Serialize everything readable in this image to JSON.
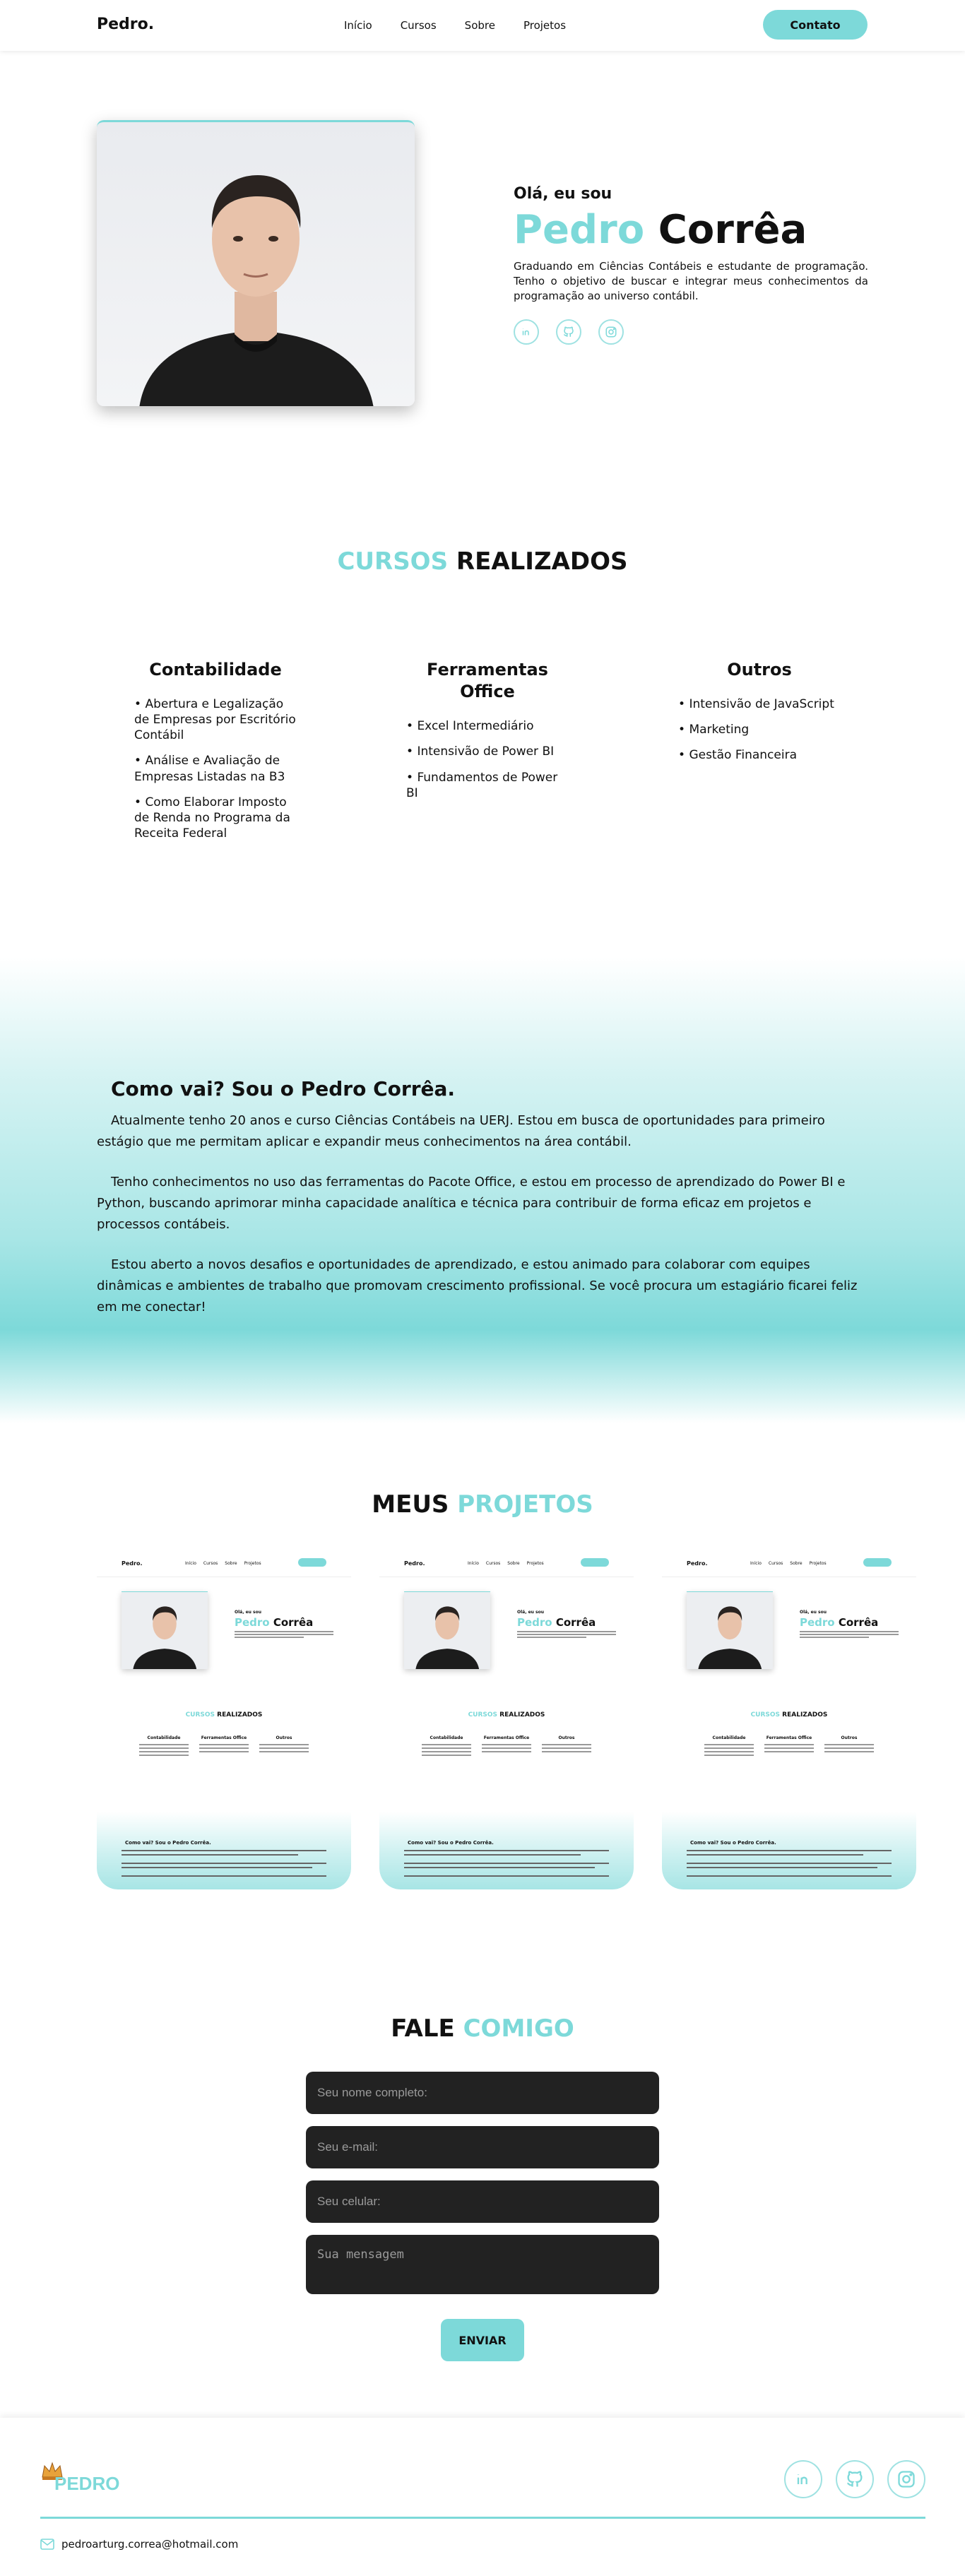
{
  "header": {
    "brand": "Pedro.",
    "nav": [
      "Início",
      "Cursos",
      "Sobre",
      "Projetos"
    ],
    "contact_button": "Contato"
  },
  "hero": {
    "greeting": "Olá, eu sou",
    "first_name": "Pedro",
    "last_name": "Corrêa",
    "bio": "Graduando em Ciências Contábeis e estudante de programação. Tenho o objetivo de buscar e integrar meus conhecimentos da programação ao universo contábil.",
    "socials": [
      "linkedin-icon",
      "github-icon",
      "instagram-icon"
    ]
  },
  "courses": {
    "title_accent": "CURSOS",
    "title_rest": "REALIZADOS",
    "columns": [
      {
        "title": "Contabilidade",
        "items": [
          "Abertura e Legalização de Empresas por Escritório Contábil",
          "Análise e Avaliação de Empresas Listadas na B3",
          "Como Elaborar Imposto de Renda no Programa da Receita Federal"
        ]
      },
      {
        "title": "Ferramentas Office",
        "items": [
          "Excel Intermediário",
          "Intensivão de Power BI",
          "Fundamentos de Power BI"
        ]
      },
      {
        "title": "Outros",
        "items": [
          "Intensivão de JavaScript",
          "Marketing",
          "Gestão Financeira"
        ]
      }
    ]
  },
  "about": {
    "title": "Como vai? Sou o Pedro Corrêa.",
    "paragraphs": [
      "Atualmente tenho 20 anos e curso Ciências Contábeis na UERJ. Estou em busca de oportunidades para primeiro estágio que me permitam aplicar e expandir meus conhecimentos na área contábil.",
      "Tenho conhecimentos no uso das ferramentas do Pacote Office, e estou em processo de aprendizado do Power BI e Python, buscando aprimorar minha capacidade analítica e técnica para contribuir de forma eficaz em projetos e processos contábeis.",
      "Estou aberto a novos desafios e oportunidades de aprendizado, e estou animado para colaborar com equipes dinâmicas e ambientes de trabalho que promovam crescimento profissional. Se você procura um estagiário ficarei feliz em me conectar!"
    ]
  },
  "projects": {
    "title_rest": "MEUS",
    "title_accent": "PROJETOS",
    "mini": {
      "brand": "Pedro.",
      "greeting": "Olá, eu sou",
      "first_name": "Pedro",
      "last_name": "Corrêa",
      "courses_accent": "CURSOS",
      "courses_rest": "REALIZADOS",
      "col1": "Contabilidade",
      "col2": "Ferramentas Office",
      "col3": "Outros",
      "about_title": "Como vai? Sou o Pedro Corrêa."
    }
  },
  "contact": {
    "title_rest": "FALE",
    "title_accent": "COMIGO",
    "name_placeholder": "Seu nome completo:",
    "email_placeholder": "Seu e-mail:",
    "phone_placeholder": "Seu celular:",
    "message_placeholder": "Sua mensagem",
    "send_label": "ENVIAR"
  },
  "footer": {
    "logo_text": "PEDRO",
    "email": "pedroarturg.correa@hotmail.com",
    "socials": [
      "linkedin-icon",
      "github-icon",
      "instagram-icon"
    ]
  },
  "colors": {
    "accent": "#7dd9d9",
    "field_bg": "#222222"
  }
}
